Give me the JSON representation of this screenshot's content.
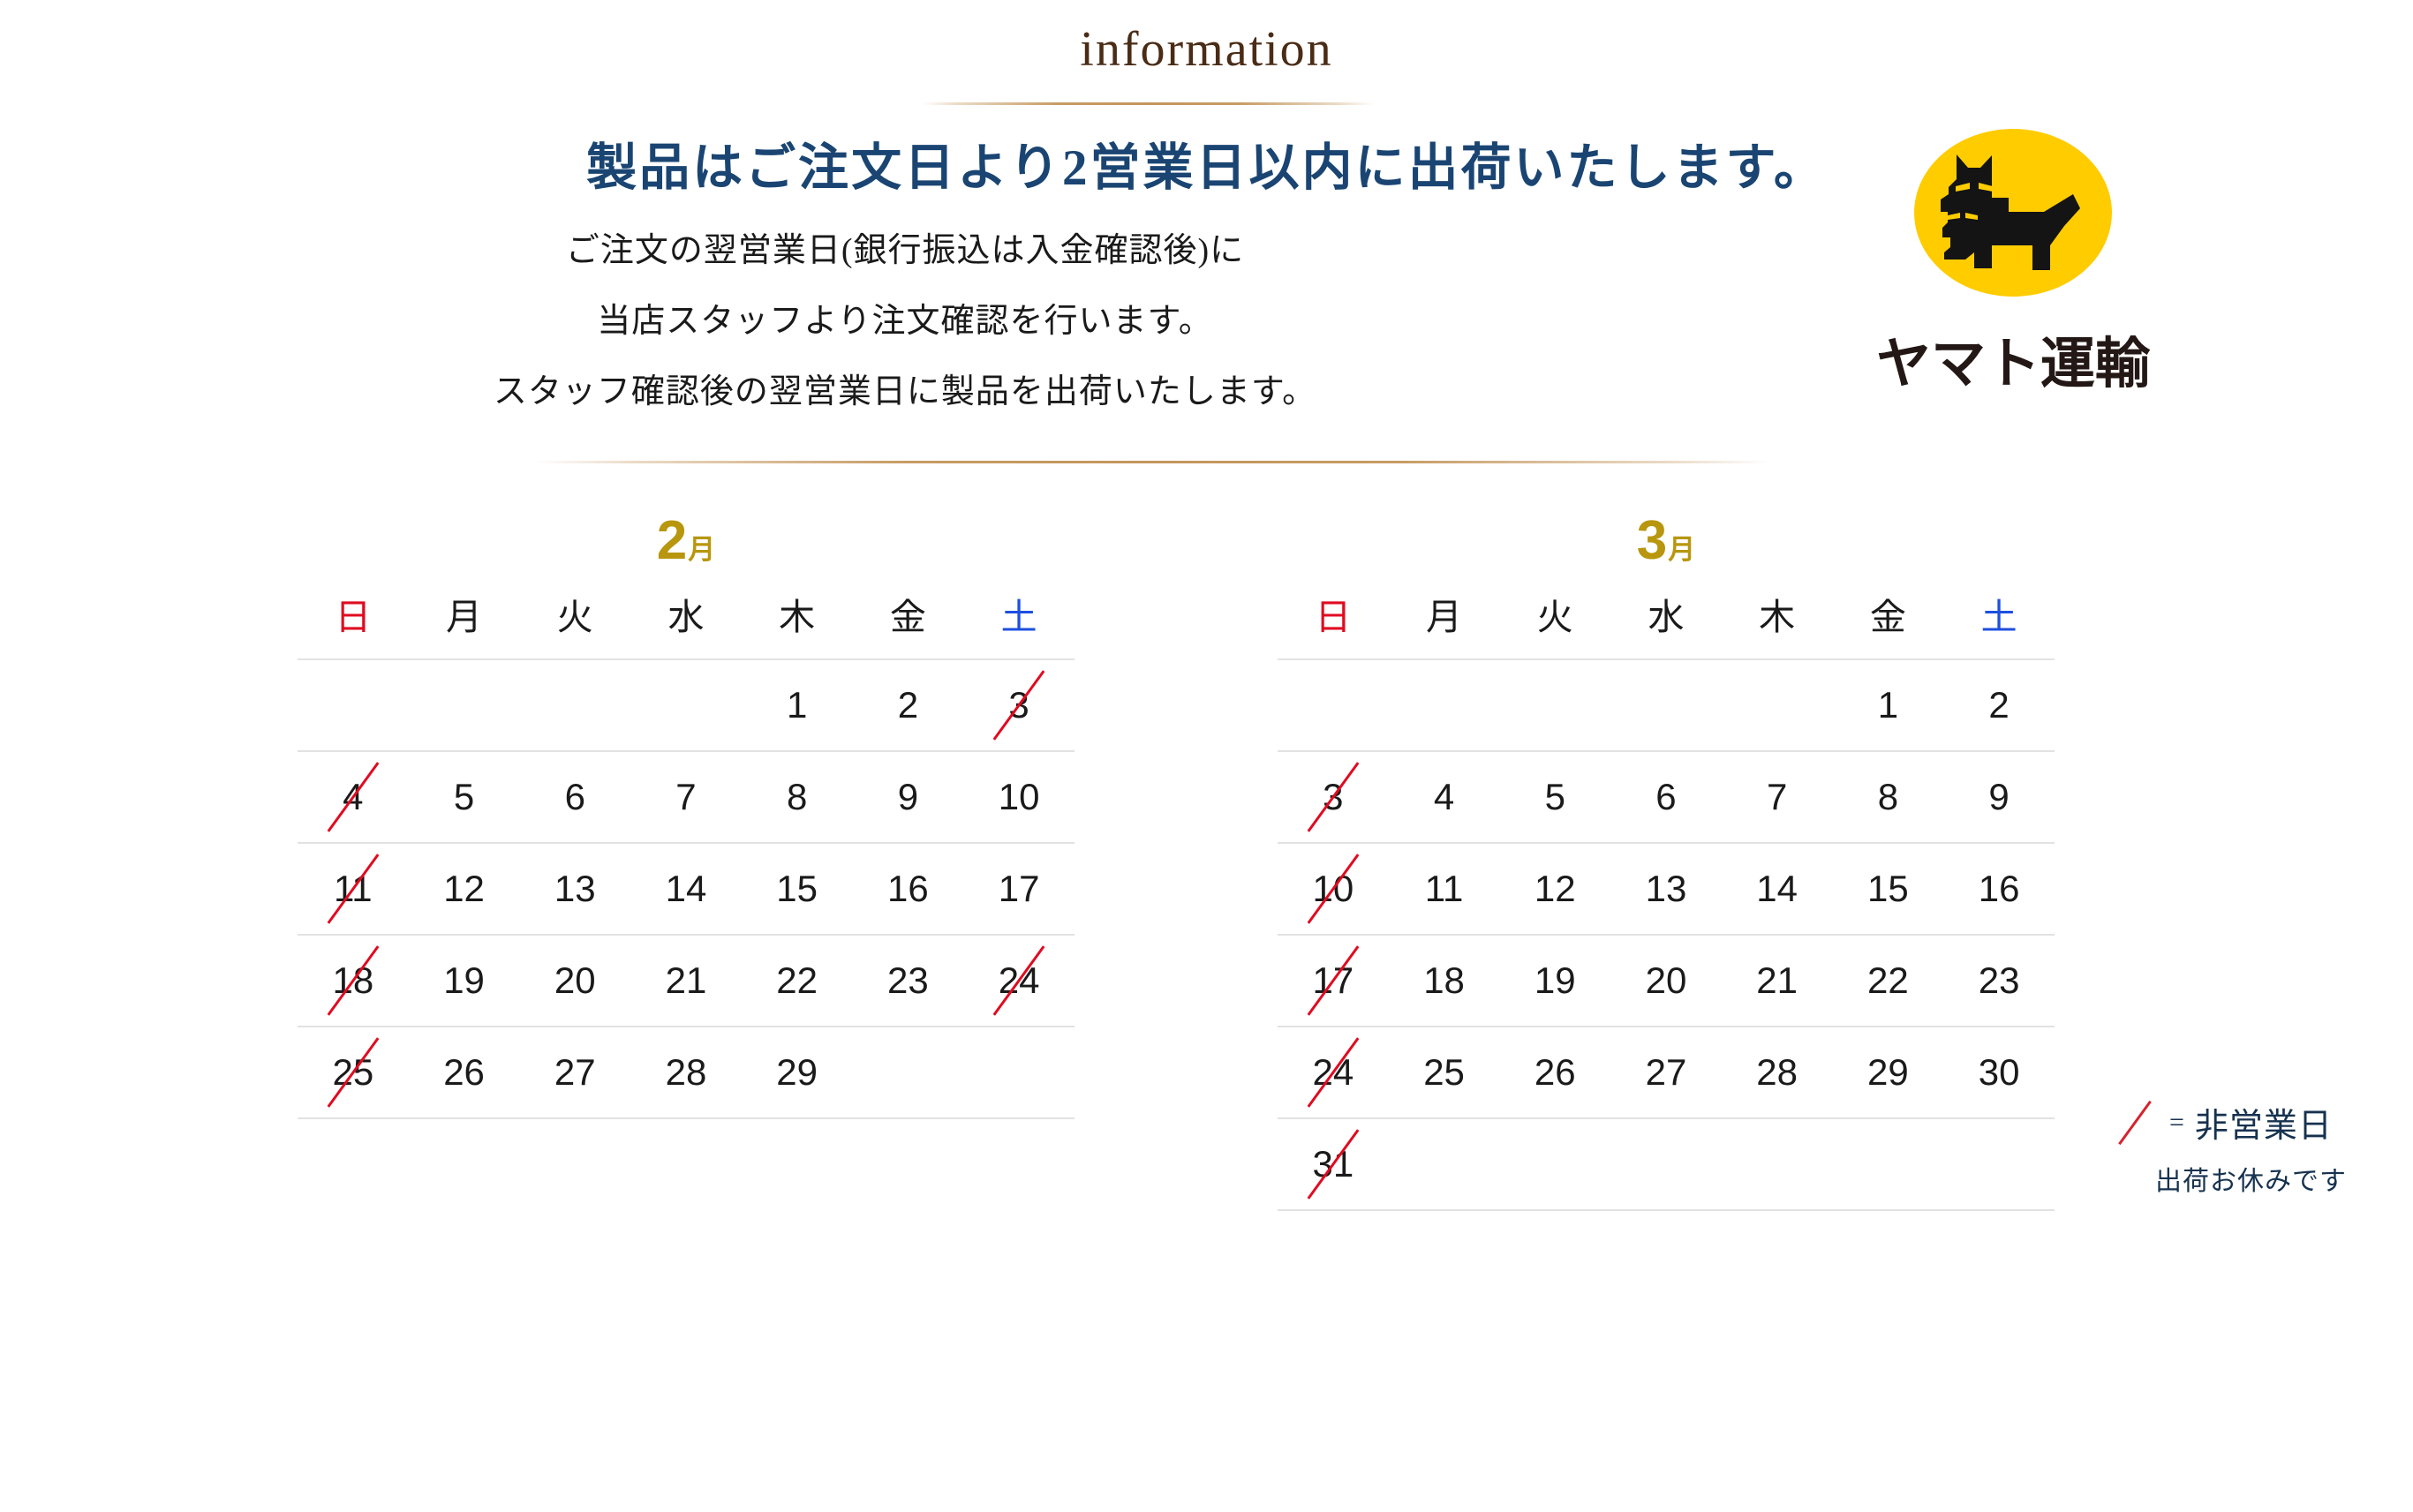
{
  "header": {
    "eyebrow": "information",
    "headline": "製品はご注文日より2営業日以内に出荷いたします。",
    "body_lines": [
      "ご注文の翌営業日(銀行振込は入金確認後)に",
      "当店スタッフより注文確認を行います。",
      "スタッフ確認後の翌営業日に製品を出荷いたします。"
    ]
  },
  "logo": {
    "name": "yamato-transport-logo",
    "wordmark": "ヤマト運輸",
    "background_color": "#FFCC00",
    "mark_color": "#1A1A1A"
  },
  "colors": {
    "heading_navy": "#1A4573",
    "eyebrow_brown": "#4A2C16",
    "divider_gold": "#C4965C",
    "month_gold": "#B8960E",
    "sunday_red": "#E00B20",
    "saturday_blue": "#1D4FE0",
    "weekday_black": "#1A1A1A",
    "closed_slash_red": "#E00B20",
    "grid_line": "#E2E2E2",
    "legend_navy": "#16324F"
  },
  "weekday_headers": [
    "日",
    "月",
    "火",
    "水",
    "木",
    "金",
    "土"
  ],
  "calendars": [
    {
      "name": "february",
      "month_number": "2",
      "month_suffix": "月",
      "weeks": [
        [
          {
            "day": "",
            "color": "empty",
            "closed": false
          },
          {
            "day": "",
            "color": "empty",
            "closed": false
          },
          {
            "day": "",
            "color": "empty",
            "closed": false
          },
          {
            "day": "",
            "color": "empty",
            "closed": false
          },
          {
            "day": "1",
            "color": "black",
            "closed": false
          },
          {
            "day": "2",
            "color": "black",
            "closed": false
          },
          {
            "day": "3",
            "color": "blue",
            "closed": true
          }
        ],
        [
          {
            "day": "4",
            "color": "red",
            "closed": true
          },
          {
            "day": "5",
            "color": "black",
            "closed": false
          },
          {
            "day": "6",
            "color": "black",
            "closed": false
          },
          {
            "day": "7",
            "color": "black",
            "closed": false
          },
          {
            "day": "8",
            "color": "black",
            "closed": false
          },
          {
            "day": "9",
            "color": "black",
            "closed": false
          },
          {
            "day": "10",
            "color": "blue",
            "closed": false
          }
        ],
        [
          {
            "day": "11",
            "color": "red",
            "closed": true
          },
          {
            "day": "12",
            "color": "red",
            "closed": false
          },
          {
            "day": "13",
            "color": "black",
            "closed": false
          },
          {
            "day": "14",
            "color": "black",
            "closed": false
          },
          {
            "day": "15",
            "color": "black",
            "closed": false
          },
          {
            "day": "16",
            "color": "black",
            "closed": false
          },
          {
            "day": "17",
            "color": "blue",
            "closed": false
          }
        ],
        [
          {
            "day": "18",
            "color": "red",
            "closed": true
          },
          {
            "day": "19",
            "color": "black",
            "closed": false
          },
          {
            "day": "20",
            "color": "black",
            "closed": false
          },
          {
            "day": "21",
            "color": "black",
            "closed": false
          },
          {
            "day": "22",
            "color": "black",
            "closed": false
          },
          {
            "day": "23",
            "color": "red",
            "closed": false
          },
          {
            "day": "24",
            "color": "blue",
            "closed": true
          }
        ],
        [
          {
            "day": "25",
            "color": "red",
            "closed": true
          },
          {
            "day": "26",
            "color": "black",
            "closed": false
          },
          {
            "day": "27",
            "color": "black",
            "closed": false
          },
          {
            "day": "28",
            "color": "black",
            "closed": false
          },
          {
            "day": "29",
            "color": "black",
            "closed": false
          },
          {
            "day": "",
            "color": "empty",
            "closed": false
          },
          {
            "day": "",
            "color": "empty",
            "closed": false
          }
        ]
      ]
    },
    {
      "name": "march",
      "month_number": "3",
      "month_suffix": "月",
      "weeks": [
        [
          {
            "day": "",
            "color": "empty",
            "closed": false
          },
          {
            "day": "",
            "color": "empty",
            "closed": false
          },
          {
            "day": "",
            "color": "empty",
            "closed": false
          },
          {
            "day": "",
            "color": "empty",
            "closed": false
          },
          {
            "day": "",
            "color": "empty",
            "closed": false
          },
          {
            "day": "1",
            "color": "black",
            "closed": false
          },
          {
            "day": "2",
            "color": "blue",
            "closed": false
          }
        ],
        [
          {
            "day": "3",
            "color": "red",
            "closed": true
          },
          {
            "day": "4",
            "color": "black",
            "closed": false
          },
          {
            "day": "5",
            "color": "black",
            "closed": false
          },
          {
            "day": "6",
            "color": "black",
            "closed": false
          },
          {
            "day": "7",
            "color": "black",
            "closed": false
          },
          {
            "day": "8",
            "color": "black",
            "closed": false
          },
          {
            "day": "9",
            "color": "blue",
            "closed": false
          }
        ],
        [
          {
            "day": "10",
            "color": "red",
            "closed": true
          },
          {
            "day": "11",
            "color": "black",
            "closed": false
          },
          {
            "day": "12",
            "color": "black",
            "closed": false
          },
          {
            "day": "13",
            "color": "black",
            "closed": false
          },
          {
            "day": "14",
            "color": "black",
            "closed": false
          },
          {
            "day": "15",
            "color": "black",
            "closed": false
          },
          {
            "day": "16",
            "color": "blue",
            "closed": false
          }
        ],
        [
          {
            "day": "17",
            "color": "red",
            "closed": true
          },
          {
            "day": "18",
            "color": "black",
            "closed": false
          },
          {
            "day": "19",
            "color": "black",
            "closed": false
          },
          {
            "day": "20",
            "color": "red",
            "closed": false
          },
          {
            "day": "21",
            "color": "black",
            "closed": false
          },
          {
            "day": "22",
            "color": "black",
            "closed": false
          },
          {
            "day": "23",
            "color": "blue",
            "closed": false
          }
        ],
        [
          {
            "day": "24",
            "color": "red",
            "closed": true
          },
          {
            "day": "25",
            "color": "black",
            "closed": false
          },
          {
            "day": "26",
            "color": "black",
            "closed": false
          },
          {
            "day": "27",
            "color": "black",
            "closed": false
          },
          {
            "day": "28",
            "color": "black",
            "closed": false
          },
          {
            "day": "29",
            "color": "black",
            "closed": false
          },
          {
            "day": "30",
            "color": "blue",
            "closed": false
          }
        ],
        [
          {
            "day": "31",
            "color": "red",
            "closed": true
          },
          {
            "day": "",
            "color": "empty",
            "closed": false
          },
          {
            "day": "",
            "color": "empty",
            "closed": false
          },
          {
            "day": "",
            "color": "empty",
            "closed": false
          },
          {
            "day": "",
            "color": "empty",
            "closed": false
          },
          {
            "day": "",
            "color": "empty",
            "closed": false
          },
          {
            "day": "",
            "color": "empty",
            "closed": false
          }
        ]
      ]
    }
  ],
  "legend": {
    "equals": "=",
    "label": "非営業日",
    "sub_label": "出荷お休みです"
  }
}
